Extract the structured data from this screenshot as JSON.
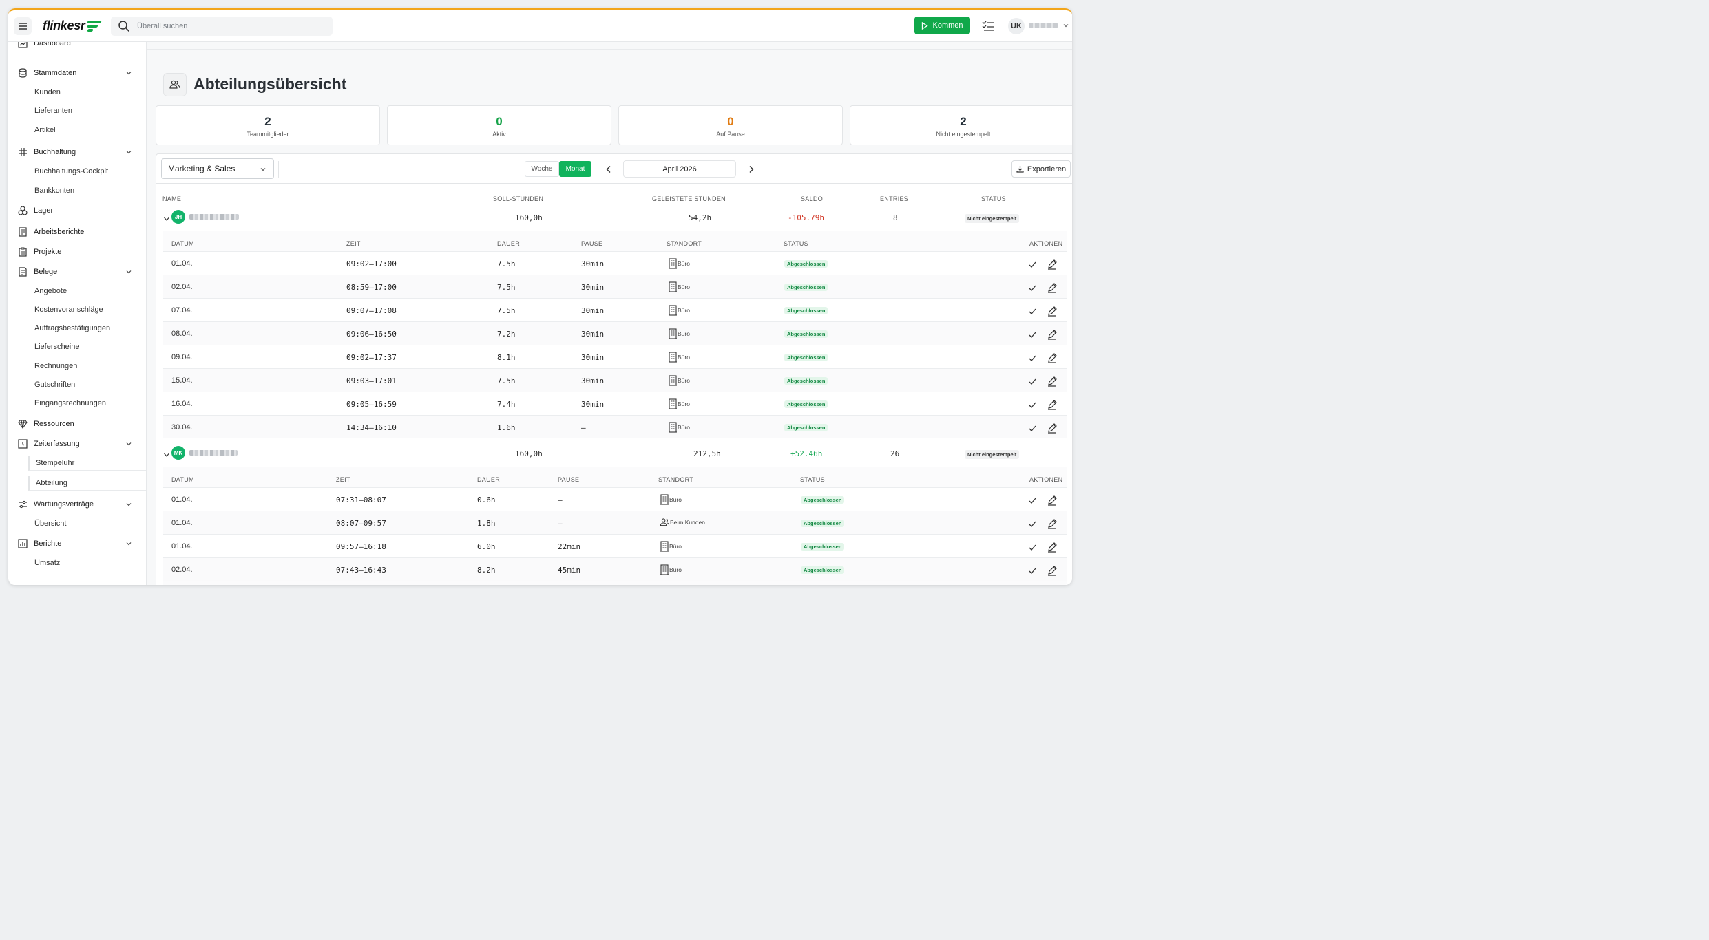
{
  "topbar": {
    "brand": "flinkesr",
    "search_placeholder": "Überall suchen",
    "kommen_label": "Kommen",
    "user_initials": "UK"
  },
  "sidebar": {
    "items": [
      {
        "label": "Dashboard",
        "icon": "chart-icon"
      },
      {
        "label": "Stammdaten",
        "icon": "database-icon",
        "expandable": true
      },
      {
        "label": "Kunden",
        "sub": true
      },
      {
        "label": "Lieferanten",
        "sub": true
      },
      {
        "label": "Artikel",
        "sub": true
      },
      {
        "label": "Buchhaltung",
        "icon": "hash-icon",
        "expandable": true
      },
      {
        "label": "Buchhaltungs-Cockpit",
        "sub": true
      },
      {
        "label": "Bankkonten",
        "sub": true
      },
      {
        "label": "Lager",
        "icon": "boxes-icon"
      },
      {
        "label": "Arbeitsberichte",
        "icon": "document-icon"
      },
      {
        "label": "Projekte",
        "icon": "clipboard-icon"
      },
      {
        "label": "Belege",
        "icon": "receipt-icon",
        "expandable": true
      },
      {
        "label": "Angebote",
        "sub": true
      },
      {
        "label": "Kostenvoranschläge",
        "sub": true
      },
      {
        "label": "Auftragsbestätigungen",
        "sub": true
      },
      {
        "label": "Lieferscheine",
        "sub": true
      },
      {
        "label": "Rechnungen",
        "sub": true
      },
      {
        "label": "Gutschriften",
        "sub": true
      },
      {
        "label": "Eingangsrechnungen",
        "sub": true
      },
      {
        "label": "Ressourcen",
        "icon": "gem-icon"
      },
      {
        "label": "Zeiterfassung",
        "icon": "clock-icon",
        "expandable": true
      },
      {
        "label": "Stempeluhr",
        "sub": true,
        "active": true
      },
      {
        "label": "Abteilung",
        "sub": true,
        "active": true
      },
      {
        "label": "Wartungsverträge",
        "icon": "wrench-icon",
        "expandable": true
      },
      {
        "label": "Übersicht",
        "sub": true
      },
      {
        "label": "Berichte",
        "icon": "bar-chart-icon",
        "expandable": true
      },
      {
        "label": "Umsatz",
        "sub": true
      }
    ]
  },
  "page": {
    "title": "Abteilungsübersicht"
  },
  "kpis": [
    {
      "value": "2",
      "label": "Teammitglieder",
      "color": "#1f2a33"
    },
    {
      "value": "0",
      "label": "Aktiv",
      "color": "#17a34a"
    },
    {
      "value": "0",
      "label": "Auf Pause",
      "color": "#e07b12"
    },
    {
      "value": "2",
      "label": "Nicht eingestempelt",
      "color": "#1f2a33"
    }
  ],
  "toolbar": {
    "department": "Marketing & Sales",
    "week_label": "Woche",
    "month_label": "Monat",
    "current_period": "April 2026",
    "export_label": "Exportieren"
  },
  "table": {
    "headers": [
      "NAME",
      "SOLL-STUNDEN",
      "GELEISTETE STUNDEN",
      "SALDO",
      "ENTRIES",
      "STATUS"
    ],
    "sub_headers": [
      "DATUM",
      "ZEIT",
      "DAUER",
      "PAUSE",
      "STANDORT",
      "STATUS",
      "AKTIONEN"
    ],
    "members": [
      {
        "initials": "JH",
        "soll": "160,0h",
        "geleistet": "54,2h",
        "saldo": "-105.79h",
        "entries": "8",
        "status": "Nicht eingestempelt",
        "rows": [
          {
            "datum": "01.04.",
            "zeit": "09:02–17:00",
            "dauer": "7.5h",
            "pause": "30min",
            "standort": "Büro",
            "status": "Abgeschlossen"
          },
          {
            "datum": "02.04.",
            "zeit": "08:59–17:00",
            "dauer": "7.5h",
            "pause": "30min",
            "standort": "Büro",
            "status": "Abgeschlossen"
          },
          {
            "datum": "07.04.",
            "zeit": "09:07–17:08",
            "dauer": "7.5h",
            "pause": "30min",
            "standort": "Büro",
            "status": "Abgeschlossen"
          },
          {
            "datum": "08.04.",
            "zeit": "09:06–16:50",
            "dauer": "7.2h",
            "pause": "30min",
            "standort": "Büro",
            "status": "Abgeschlossen"
          },
          {
            "datum": "09.04.",
            "zeit": "09:02–17:37",
            "dauer": "8.1h",
            "pause": "30min",
            "standort": "Büro",
            "status": "Abgeschlossen"
          },
          {
            "datum": "15.04.",
            "zeit": "09:03–17:01",
            "dauer": "7.5h",
            "pause": "30min",
            "standort": "Büro",
            "status": "Abgeschlossen"
          },
          {
            "datum": "16.04.",
            "zeit": "09:05–16:59",
            "dauer": "7.4h",
            "pause": "30min",
            "standort": "Büro",
            "status": "Abgeschlossen"
          },
          {
            "datum": "30.04.",
            "zeit": "14:34–16:10",
            "dauer": "1.6h",
            "pause": "–",
            "standort": "Büro",
            "status": "Abgeschlossen"
          }
        ]
      },
      {
        "initials": "MK",
        "soll": "160,0h",
        "geleistet": "212,5h",
        "saldo": "+52.46h",
        "entries": "26",
        "status": "Nicht eingestempelt",
        "rows": [
          {
            "datum": "01.04.",
            "zeit": "07:31–08:07",
            "dauer": "0.6h",
            "pause": "–",
            "standort": "Büro",
            "status": "Abgeschlossen"
          },
          {
            "datum": "01.04.",
            "zeit": "08:07–09:57",
            "dauer": "1.8h",
            "pause": "–",
            "standort": "Beim Kunden",
            "status": "Abgeschlossen"
          },
          {
            "datum": "01.04.",
            "zeit": "09:57–16:18",
            "dauer": "6.0h",
            "pause": "22min",
            "standort": "Büro",
            "status": "Abgeschlossen"
          },
          {
            "datum": "02.04.",
            "zeit": "07:43–16:43",
            "dauer": "8.2h",
            "pause": "45min",
            "standort": "Büro",
            "status": "Abgeschlossen"
          }
        ]
      }
    ]
  }
}
